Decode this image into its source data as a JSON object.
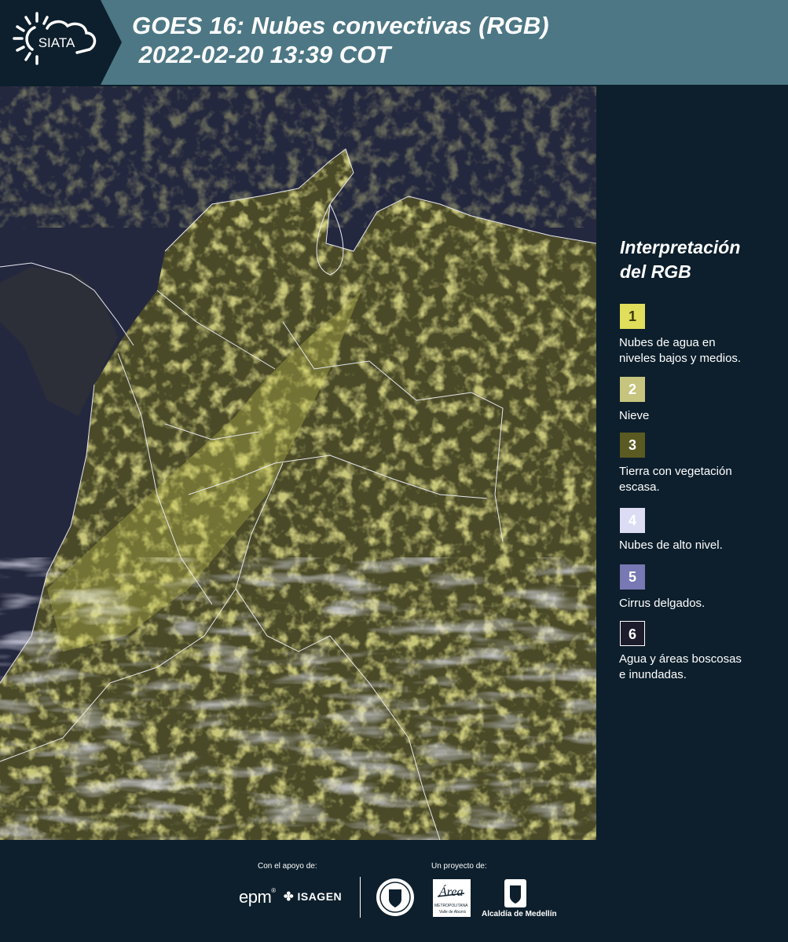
{
  "header": {
    "logo_text": "SIATA",
    "title_line1": "GOES 16: Nubes convectivas (RGB)",
    "title_line2": " 2022-02-20 13:39 COT"
  },
  "map": {
    "icon": "satellite-rgb-map"
  },
  "legend": {
    "title_line1": "Interpretación",
    "title_line2": "del RGB",
    "items": [
      {
        "num": "1",
        "color": "#e0de5a",
        "text_color": "#3a3a10",
        "lines": [
          "Nubes de agua en",
          "niveles bajos y medios."
        ]
      },
      {
        "num": "2",
        "color": "#c6c47e",
        "text_color": "#ffffff",
        "lines": [
          "Nieve",
          ""
        ]
      },
      {
        "num": "3",
        "color": "#5a5a22",
        "text_color": "#ffffff",
        "lines": [
          "Tierra con vegetación",
          "escasa."
        ]
      },
      {
        "num": "4",
        "color": "#dcdcf4",
        "text_color": "#ffffff",
        "lines": [
          "Nubes de alto nivel.",
          ""
        ]
      },
      {
        "num": "5",
        "color": "#7878b4",
        "text_color": "#ffffff",
        "lines": [
          "Cirrus delgados.",
          ""
        ]
      },
      {
        "num": "6",
        "color": "#1c1c2c",
        "text_color": "#ffffff",
        "lines": [
          "Agua y áreas boscosas",
          "e inundadas."
        ]
      }
    ]
  },
  "footer": {
    "support_label": "Con el apoyo de:",
    "project_label": "Un proyecto de:",
    "epm": "epm",
    "isagen": "ISAGEN",
    "metropolitana": "METROPOLITANA",
    "valle": "Valle de Aburrá",
    "area": "Área",
    "alcaldia": "Alcaldía de Medellín"
  }
}
